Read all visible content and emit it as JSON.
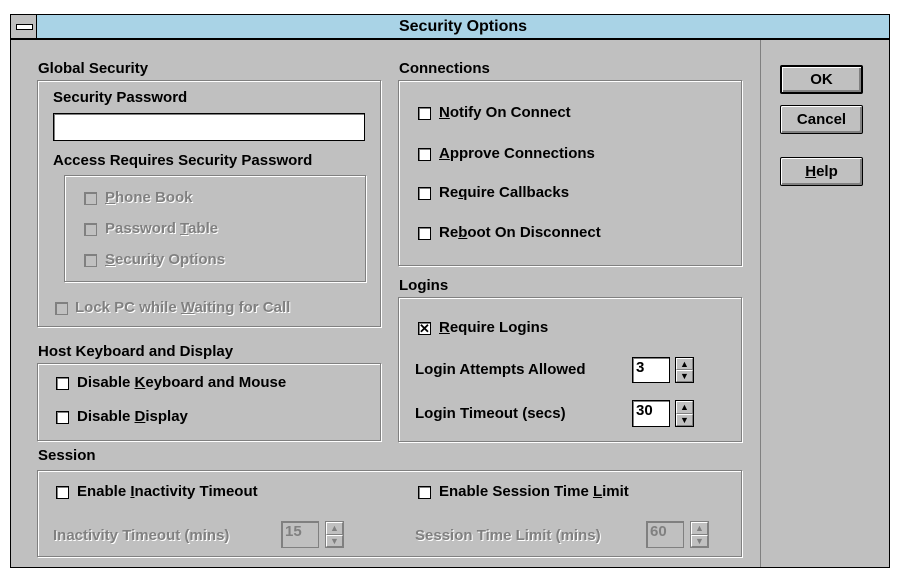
{
  "window": {
    "title": "Security Options"
  },
  "global_security": {
    "heading": "Global Security",
    "password_label": "Security Password",
    "password_value": "",
    "access_label": "Access Requires Security Password",
    "access_items": [
      {
        "pre": "",
        "key": "P",
        "post": "hone Book",
        "checked": false,
        "enabled": false
      },
      {
        "pre": "Password ",
        "key": "T",
        "post": "able",
        "checked": false,
        "enabled": false
      },
      {
        "pre": "",
        "key": "S",
        "post": "ecurity Options",
        "checked": false,
        "enabled": false
      }
    ],
    "lock_pc": {
      "pre": "Lock PC while ",
      "key": "W",
      "post": "aiting for Call",
      "checked": false,
      "enabled": false
    }
  },
  "host": {
    "heading": "Host Keyboard and Display",
    "disable_keyboard": {
      "pre": "Disable ",
      "key": "K",
      "post": "eyboard and Mouse",
      "checked": false
    },
    "disable_display": {
      "pre": "Disable ",
      "key": "D",
      "post": "isplay",
      "checked": false
    }
  },
  "connections": {
    "heading": "Connections",
    "items": [
      {
        "pre": "",
        "key": "N",
        "post": "otify On Connect",
        "checked": false
      },
      {
        "pre": "",
        "key": "A",
        "post": "pprove Connections",
        "checked": false
      },
      {
        "pre": "Re",
        "key": "q",
        "post": "uire Callbacks",
        "checked": false
      },
      {
        "pre": "Re",
        "key": "b",
        "post": "oot On Disconnect",
        "checked": false
      }
    ]
  },
  "logins": {
    "heading": "Logins",
    "require": {
      "pre": "",
      "key": "R",
      "post": "equire Logins",
      "checked": true,
      "mark": "✕"
    },
    "attempts_label": "Login Attempts Allowed",
    "attempts_value": "3",
    "timeout_label": "Login Timeout (secs)",
    "timeout_value": "30"
  },
  "session": {
    "heading": "Session",
    "inactivity": {
      "pre": "Enable ",
      "key": "I",
      "post": "nactivity Timeout",
      "checked": false
    },
    "inactivity_label": "Inactivity Timeout (mins)",
    "inactivity_value": "15",
    "time_limit": {
      "pre": "Enable Session Time ",
      "key": "L",
      "post": "imit",
      "checked": false
    },
    "time_limit_label": "Session Time Limit (mins)",
    "time_limit_value": "60"
  },
  "buttons": {
    "ok": "OK",
    "cancel": "Cancel",
    "help_key": "H",
    "help_rest": "elp"
  },
  "icons": {
    "system_menu": "system-menu-icon",
    "spin_up": "▲",
    "spin_down": "▼"
  },
  "colors": {
    "titlebar": "#a9d3e6",
    "face": "#c0c0c0",
    "disabled_text": "#808080"
  }
}
